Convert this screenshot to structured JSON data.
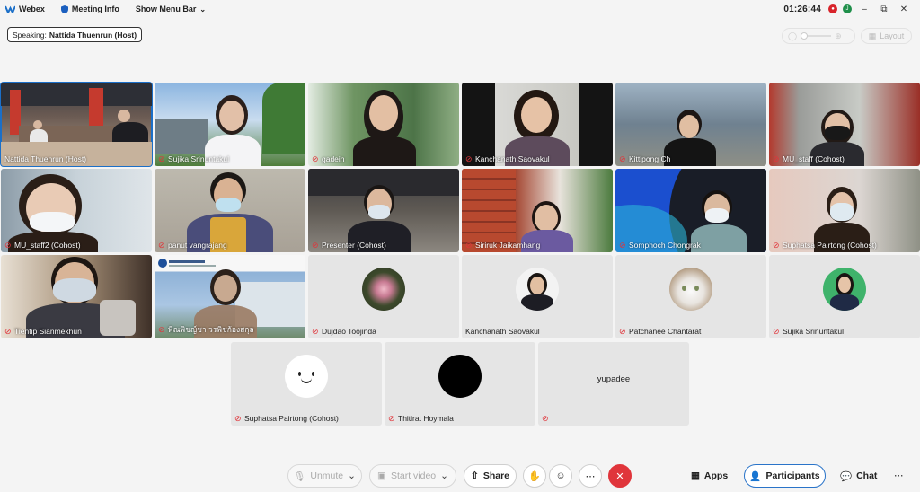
{
  "titlebar": {
    "app_name": "Webex",
    "meeting_info": "Meeting Info",
    "show_menu": "Show Menu Bar",
    "clock": "01:26:44",
    "user_initial": "J"
  },
  "speaking": {
    "prefix": "Speaking:",
    "name": "Nattida Thuenrun (Host)"
  },
  "layout_label": "Layout",
  "tiles": [
    {
      "name": "Nattida Thuenrun (Host)",
      "muted": false
    },
    {
      "name": "Sujika Srinuntakul",
      "muted": true
    },
    {
      "name": "gadein",
      "muted": true
    },
    {
      "name": "Kanchanath Saovakul",
      "muted": true
    },
    {
      "name": "Kittipong Ch",
      "muted": true
    },
    {
      "name": "MU_staff (Cohost)",
      "muted": true
    },
    {
      "name": "MU_staff2 (Cohost)",
      "muted": true
    },
    {
      "name": "panut vangrajang",
      "muted": true
    },
    {
      "name": "Presenter (Cohost)",
      "muted": true
    },
    {
      "name": "Siriruk Jaikamhang",
      "muted": true
    },
    {
      "name": "Somphoch Chongrak",
      "muted": true
    },
    {
      "name": "Suphatsa Pairtong (Cohost)",
      "muted": true
    },
    {
      "name": "Tientip Sianmekhun",
      "muted": true
    },
    {
      "name": "พิณพิชญ์ชา วรพิชก้องสกุล",
      "muted": true
    },
    {
      "name": "Dujdao Toojinda",
      "muted": true
    },
    {
      "name": "Kanchanath Saovakul",
      "muted": false
    },
    {
      "name": "Patchanee Chantarat",
      "muted": true
    },
    {
      "name": "Sujika Srinuntakul",
      "muted": true
    },
    {
      "name": "Suphatsa Pairtong (Cohost)",
      "muted": true
    },
    {
      "name": "Thitirat Hoymala",
      "muted": true
    },
    {
      "name": "",
      "muted": true,
      "center_name": "yupadee"
    }
  ],
  "controls": {
    "unmute": "Unmute",
    "start_video": "Start video",
    "share": "Share",
    "apps": "Apps",
    "participants": "Participants",
    "chat": "Chat"
  },
  "colors": {
    "accent": "#1b6fc8",
    "end": "#e0353b"
  }
}
